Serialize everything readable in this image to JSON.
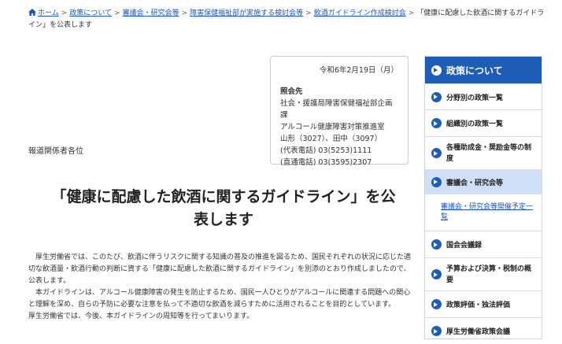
{
  "breadcrumb": {
    "items": [
      "ホーム",
      "政策について",
      "審議会・研究会等",
      "障害保健福祉部が実施する検討会等",
      "飲酒ガイドライン作成検討会"
    ],
    "current": "「健康に配慮した飲酒に関するガイドライン」を公表します"
  },
  "contact": {
    "date": "令和6年2月19日（月）",
    "heading": "照会先",
    "lines": [
      "社会・援護局障害保健福祉部企画課",
      "アルコール健康障害対策推進室",
      "山形（3027）、田中（3097）",
      "(代表電話) 03(5253)1111",
      "(直通電話) 03(3595)2307"
    ]
  },
  "recipients": "報道関係者各位",
  "title": "「健康に配慮した飲酒に関するガイドライン」を公表します",
  "body": {
    "p1": "　厚生労働省では、このたび、飲酒に伴うリスクに関する知識の普及の推進を図るため、国民それぞれの状況に応じた適切な飲酒量・飲酒行動の判断に資する「健康に配慮した飲酒に関するガイドライン」を別添のとおり作成しましたので、公表します。",
    "p2": "　本ガイドラインは、アルコール健康障害の発生を防止するため、国民一人ひとりがアルコールに関連する問題への関心と理解を深め、自らの予防に必要な注意を払って不適切な飲酒を減らすために活用されることを目的としています。",
    "p3": "厚生労働省では、今後、本ガイドラインの周知等を行ってまいります。"
  },
  "sidebar": {
    "header": "政策について",
    "items": [
      {
        "label": "分野別の政策一覧"
      },
      {
        "label": "組織別の政策一覧"
      },
      {
        "label": "各種助成金・奨励金等の制度"
      },
      {
        "label": "審議会・研究会等"
      },
      {
        "label": "国会会議録"
      },
      {
        "label": "予算および決算・税制の概要"
      },
      {
        "label": "政策評価・独法評価"
      },
      {
        "label": "厚生労働省政策会議"
      }
    ],
    "sub_link": "審議会・研究会等開催予定一覧"
  },
  "colors": {
    "accent": "#1f5cb8",
    "link": "#1a57b8",
    "active_bg": "#cfe0f6"
  }
}
